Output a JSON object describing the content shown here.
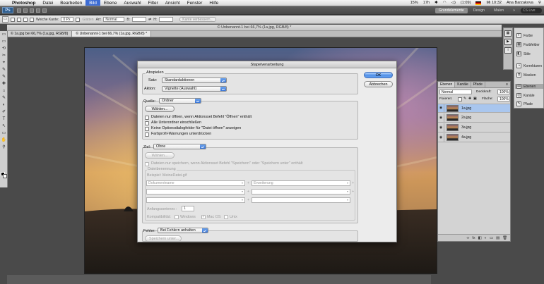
{
  "menubar": {
    "app": "Photoshop",
    "items": [
      "Datei",
      "Bearbeiten",
      "Bild",
      "Ebene",
      "Auswahl",
      "Filter",
      "Ansicht",
      "Fenster",
      "Hilfe"
    ],
    "selected": "Bild",
    "status": {
      "battery": "15%",
      "time_battery": "17h",
      "battery_time": "(1:09)",
      "clock": "Mi 10:32",
      "user": "Ana Barzakova"
    }
  },
  "appbar": {
    "logo": "Ps",
    "workspaces": [
      "Grundelemente",
      "Design",
      "Malen",
      "»"
    ],
    "active_workspace": "Grundelemente",
    "search": "CS Live"
  },
  "optionsbar": {
    "weiche_kante_label": "Weiche Kante:",
    "weiche_kante_value": "0 Px",
    "glaetten_label": "Glätten",
    "art_label": "Art:",
    "art_value": "Normal",
    "b_label": "B:",
    "h_label": "H:",
    "kante_button": "Kante verbessern..."
  },
  "document": {
    "title": "© Unbenannt-1 bei 66,7% (1a.jpg, RGB/8) *",
    "tabs": [
      "© 1a.jpg bei 66,7% (1a.jpg, RGB/8)",
      "© Unbenannt-1 bei 66,7% (1a.jpg, RGB/8) *"
    ],
    "active_tab": 1
  },
  "toolbox": {
    "tools": [
      "▭",
      "▭",
      "⟲",
      "✂",
      "⌖",
      "✎",
      "✎",
      "✚",
      "⌂",
      "✎",
      "◐",
      "✐",
      "T",
      "↖",
      "▭",
      "✋",
      "⚲"
    ]
  },
  "dialog": {
    "title": "Stapelverarbeitung",
    "ok": "OK",
    "cancel": "Abbrechen",
    "abspielen": {
      "legend": "Abspielen",
      "satz_label": "Satz:",
      "satz_value": "Standardaktionen",
      "aktion_label": "Aktion:",
      "aktion_value": "Vignette (Auswahl)"
    },
    "quelle": {
      "legend": "Quelle:",
      "value": "Ordner",
      "choose": "Wählen...",
      "options": [
        "Dateien nur öffnen, wenn Aktionsset Befehl \"Öffnen\" enthält",
        "Alle Unterordner einschließen",
        "Keine Optionsdialogfelder für \"Datei öffnen\" anzeigen",
        "Farbprofil-Warnungen unterdrücken"
      ]
    },
    "ziel": {
      "legend": "Ziel:",
      "value": "Ohne",
      "choose": "Wählen...",
      "override": "Dateien nur speichern, wenn Aktionsset Befehl \"Speichern\" oder \"Speichern unter\" enthält",
      "naming_legend": "Dateibenennung",
      "example": "Beispiel: MeineDatei.gif",
      "field1": "Dokumentname",
      "field2": "Erweiterung",
      "plus": "+",
      "start_label": "Anfangsseriennr.:",
      "start_value": "1",
      "compat_label": "Kompatibilität:",
      "compat": [
        "Windows",
        "Mac OS",
        "Unix"
      ],
      "compat_checked": "Mac OS"
    },
    "fehler": {
      "legend": "Fehler:",
      "value": "Bei Fehlern anhalten",
      "save_as": "Speichern unter..."
    }
  },
  "panel_strip": {
    "items": [
      "Farbe",
      "Farbfelder",
      "Stile",
      "Korrekturen",
      "Masken",
      "Ebenen",
      "Kanäle",
      "Pfade"
    ],
    "selected": "Ebenen"
  },
  "layers": {
    "tabs": [
      "Ebenen",
      "Kanäle",
      "Pfade"
    ],
    "blend_mode": "Normal",
    "deckkraft_label": "Deckkraft:",
    "deckkraft_value": "100%",
    "fixieren_label": "Fixieren:",
    "flaeche_label": "Fläche:",
    "flaeche_value": "100%",
    "rows": [
      "1a.jpg",
      "2a.jpg",
      "3a.jpg",
      "4a.jpg"
    ],
    "selected_row": "1a.jpg",
    "footer_icons": [
      "∞",
      "fx",
      "◧",
      "◐",
      "▭",
      "▤",
      "🗑"
    ]
  }
}
